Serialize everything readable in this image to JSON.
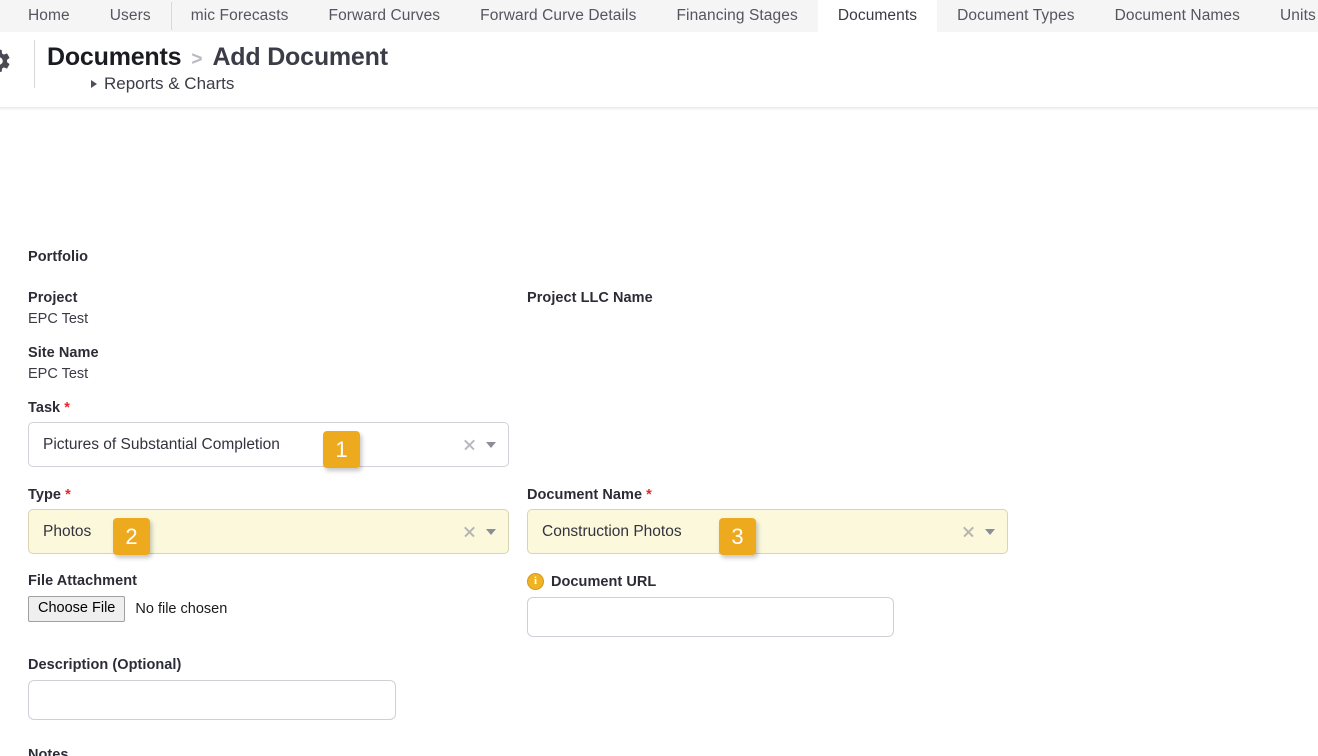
{
  "topnav": {
    "items": [
      {
        "label": "Home",
        "active": false,
        "divider": false
      },
      {
        "label": "Users",
        "active": false,
        "divider": false
      },
      {
        "label": "mic Forecasts",
        "active": false,
        "divider": true
      },
      {
        "label": "Forward Curves",
        "active": false,
        "divider": false
      },
      {
        "label": "Forward Curve Details",
        "active": false,
        "divider": false
      },
      {
        "label": "Financing Stages",
        "active": false,
        "divider": false
      },
      {
        "label": "Documents",
        "active": true,
        "divider": false
      },
      {
        "label": "Document Types",
        "active": false,
        "divider": false
      },
      {
        "label": "Document Names",
        "active": false,
        "divider": false
      },
      {
        "label": "Units",
        "active": false,
        "divider": false
      }
    ]
  },
  "header": {
    "gear_icon": "gear-icon",
    "breadcrumb_root": "Documents",
    "breadcrumb_separator": ">",
    "breadcrumb_current": "Add Document",
    "subnav_caret": "caret-right-icon",
    "subnav_label": "Reports & Charts"
  },
  "form": {
    "portfolio_label": "Portfolio",
    "project_label": "Project",
    "project_value": "EPC Test",
    "site_name_label": "Site Name",
    "site_name_value": "EPC Test",
    "project_llc_label": "Project LLC Name",
    "project_llc_value": "",
    "task_label": "Task",
    "task_required": "*",
    "task_value": "Pictures of Substantial Completion",
    "type_label": "Type",
    "type_required": "*",
    "type_value": "Photos",
    "document_name_label": "Document Name",
    "document_name_required": "*",
    "document_name_value": "Construction Photos",
    "file_attachment_label": "File Attachment",
    "choose_file_label": "Choose File",
    "no_file_text": "No file chosen",
    "document_url_label": "Document URL",
    "document_url_info_icon": "info-icon",
    "document_url_value": "",
    "description_label": "Description (Optional)",
    "description_value": "",
    "notes_label": "Notes",
    "clear_icon": "clear-x-icon",
    "dropdown_icon": "chevron-down-icon"
  },
  "annotations": {
    "badge1": "1",
    "badge2": "2",
    "badge3": "3",
    "color": "#eeaa1e"
  }
}
